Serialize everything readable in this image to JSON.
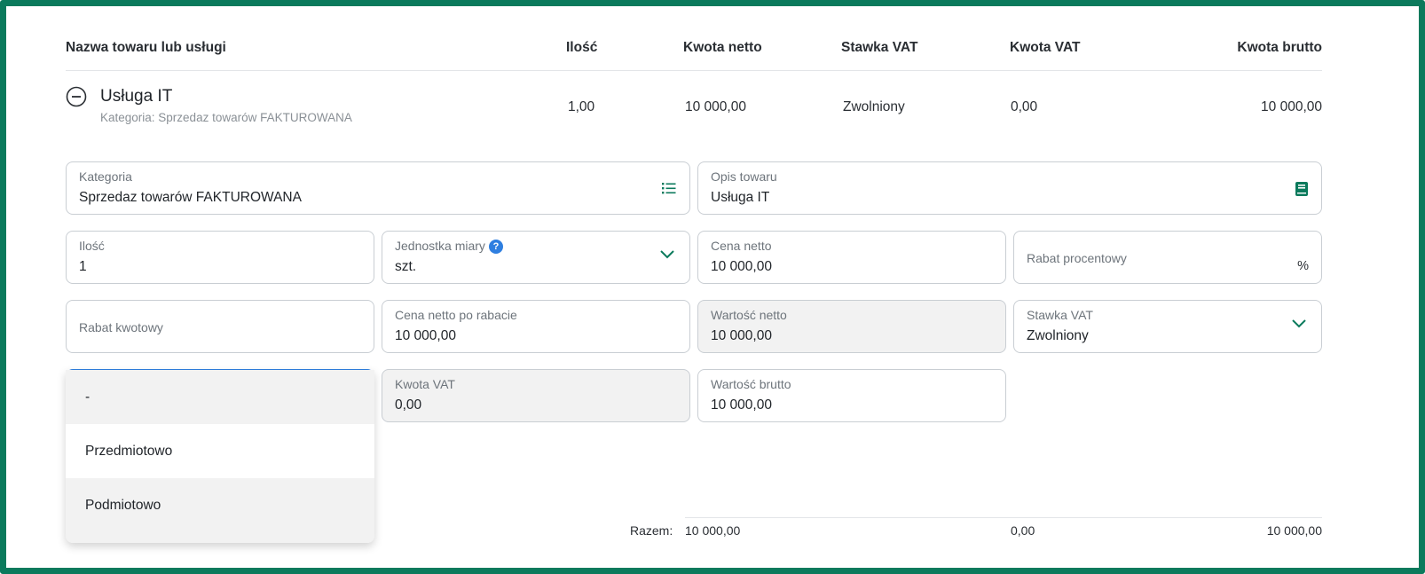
{
  "table": {
    "headers": {
      "name": "Nazwa towaru lub usługi",
      "qty": "Ilość",
      "net": "Kwota netto",
      "vat_rate": "Stawka VAT",
      "vat_amount": "Kwota VAT",
      "gross": "Kwota brutto"
    },
    "row": {
      "name": "Usługa IT",
      "category": "Kategoria: Sprzedaz towarów FAKTUROWANA",
      "qty": "1,00",
      "net": "10 000,00",
      "vat_rate": "Zwolniony",
      "vat_amount": "0,00",
      "gross": "10 000,00"
    }
  },
  "form": {
    "kategoria": {
      "label": "Kategoria",
      "value": "Sprzedaz towarów FAKTUROWANA"
    },
    "opis": {
      "label": "Opis towaru",
      "value": "Usługa IT"
    },
    "ilosc": {
      "label": "Ilość",
      "value": "1"
    },
    "jednostka": {
      "label": "Jednostka miary",
      "value": "szt.",
      "help": "?"
    },
    "cena_netto": {
      "label": "Cena netto",
      "value": "10 000,00"
    },
    "rabat_procentowy": {
      "label": "Rabat procentowy",
      "suffix": "%"
    },
    "rabat_kwotowy": {
      "label": "Rabat kwotowy"
    },
    "cena_po_rabacie": {
      "label": "Cena netto po rabacie",
      "value": "10 000,00"
    },
    "wartosc_netto": {
      "label": "Wartość netto",
      "value": "10 000,00"
    },
    "stawka_vat": {
      "label": "Stawka VAT",
      "value": "Zwolniony"
    },
    "kwota_vat": {
      "label": "Kwota VAT",
      "value": "0,00"
    },
    "wartosc_brutto": {
      "label": "Wartość brutto",
      "value": "10 000,00"
    }
  },
  "dropdown": {
    "options": [
      "-",
      "Przedmiotowo",
      "Podmiotowo"
    ]
  },
  "totals": {
    "label": "Razem:",
    "net": "10 000,00",
    "vat": "0,00",
    "gross": "10 000,00"
  },
  "colors": {
    "frame": "#0b7a5c",
    "icon_green": "#0b7a5c",
    "focus_blue": "#2f7fe0"
  },
  "icons": {
    "collapse": "minus-circle-icon",
    "category_list": "list-icon",
    "description_book": "book-icon",
    "chevron": "chevron-down-icon"
  }
}
